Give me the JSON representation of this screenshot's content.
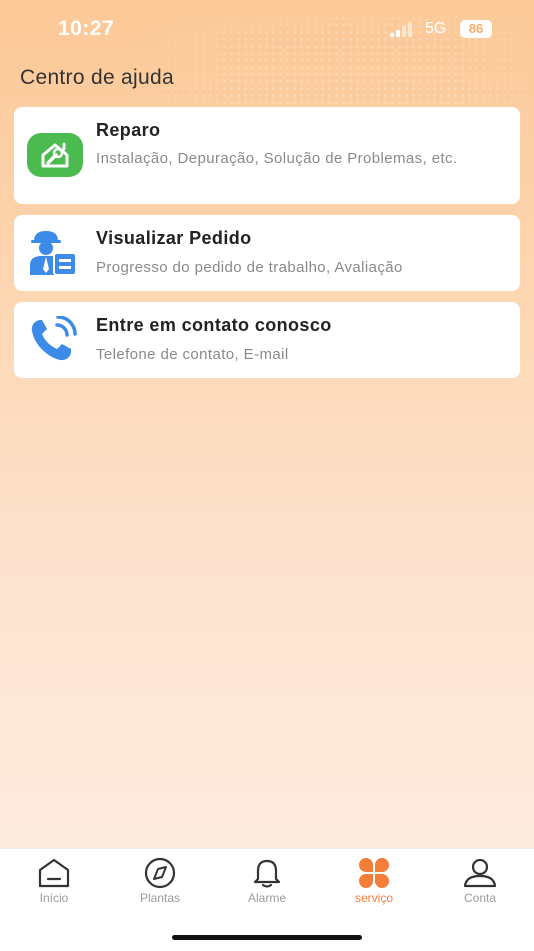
{
  "status_bar": {
    "time": "10:27",
    "network": "5G",
    "battery": "86"
  },
  "page": {
    "title": "Centro de ajuda"
  },
  "cards": [
    {
      "title": "Reparo",
      "description": "Instalação, Depuração, Solução de Problemas, etc.",
      "icon": "repair-house-icon",
      "icon_color": "#4cbb4f"
    },
    {
      "title": "Visualizar Pedido",
      "description": "Progresso do pedido de trabalho, Avaliação",
      "icon": "worker-order-icon",
      "icon_color": "#3d8be8"
    },
    {
      "title": "Entre em contato conosco",
      "description": "Telefone de contato, E-mail",
      "icon": "phone-call-icon",
      "icon_color": "#3d8be8"
    }
  ],
  "tab_bar": {
    "items": [
      {
        "label": "Início",
        "icon": "home-icon"
      },
      {
        "label": "Plantas",
        "icon": "compass-icon"
      },
      {
        "label": "Alarme",
        "icon": "bell-icon"
      },
      {
        "label": "serviço",
        "icon": "service-petals-icon",
        "active": true
      },
      {
        "label": "Conta",
        "icon": "user-icon"
      }
    ],
    "active_color": "#f47d3a",
    "inactive_color": "#9c9c9c"
  }
}
